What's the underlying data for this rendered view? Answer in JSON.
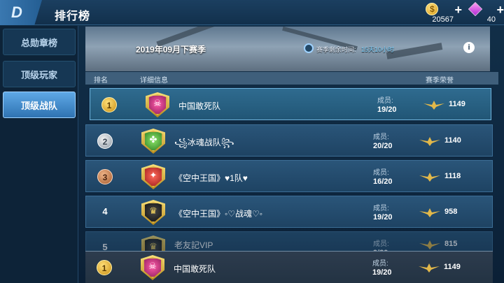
{
  "topbar": {
    "back_icon_label": "D",
    "title": "排行榜"
  },
  "currency": {
    "coins": "20567",
    "gems": "40"
  },
  "sidebar": {
    "items": [
      {
        "label": "总勋章榜",
        "active": false
      },
      {
        "label": "顶级玩家",
        "active": false
      },
      {
        "label": "顶级战队",
        "active": true
      }
    ]
  },
  "banner": {
    "season": "2019年09月下赛季",
    "remain_label": "赛季剩余时间:",
    "remain_value": "15天10小时"
  },
  "table": {
    "headers": {
      "rank": "排名",
      "details": "详细信息",
      "honor": "赛季荣誉"
    }
  },
  "rows": [
    {
      "rank": "1",
      "medal": "gold",
      "badge": "skull",
      "name": "中国敢死队",
      "members_label": "成员:",
      "members": "19/20",
      "honor": "1149"
    },
    {
      "rank": "2",
      "medal": "silver",
      "badge": "clover",
      "name": "꧁冰魂战队꧂",
      "members_label": "成员:",
      "members": "20/20",
      "honor": "1140"
    },
    {
      "rank": "3",
      "medal": "bronze",
      "badge": "wolf",
      "name": "《空中王国》♥1队♥",
      "members_label": "成员:",
      "members": "16/20",
      "honor": "1118"
    },
    {
      "rank": "4",
      "medal": "none",
      "badge": "crown",
      "name": "《空中王国》◦♡战魂♡◦",
      "members_label": "成员:",
      "members": "19/20",
      "honor": "958"
    },
    {
      "rank": "5",
      "medal": "none",
      "badge": "crown",
      "name": "老友記VIP",
      "members_label": "成员:",
      "members": "9/20",
      "honor": "815"
    }
  ],
  "self_row": {
    "rank": "1",
    "name": "中国敢死队",
    "members_label": "成员:",
    "members": "19/20",
    "honor": "1149"
  }
}
